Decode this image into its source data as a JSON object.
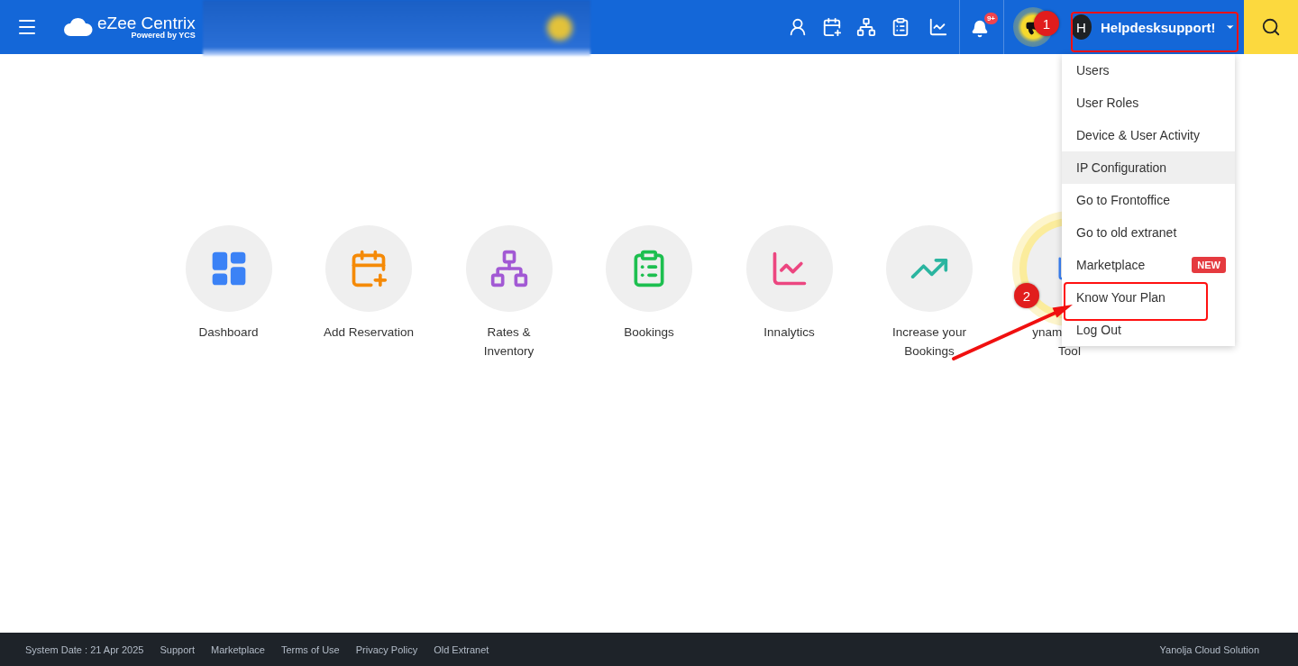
{
  "header": {
    "logo": {
      "name": "eZee Centrix",
      "tagline": "Powered by YCS"
    },
    "notifications": {
      "badge": "9+"
    },
    "user": {
      "initial": "H",
      "name": "Helpdesksupport!"
    }
  },
  "user_menu": {
    "open": true,
    "items": [
      {
        "label": "Users",
        "selected": false
      },
      {
        "label": "User Roles",
        "selected": false
      },
      {
        "label": "Device & User Activity",
        "selected": false
      },
      {
        "label": "IP Configuration",
        "selected": true
      },
      {
        "label": "Go to Frontoffice",
        "selected": false
      },
      {
        "label": "Go to old extranet",
        "selected": false
      },
      {
        "label": "Marketplace",
        "selected": false,
        "badge": "NEW"
      },
      {
        "label": "Know Your Plan",
        "selected": false
      },
      {
        "label": "Log Out",
        "selected": false
      }
    ]
  },
  "tiles": [
    {
      "lines": [
        "Dashboard"
      ],
      "highlighted": false
    },
    {
      "lines": [
        "Add Reservation"
      ],
      "highlighted": false
    },
    {
      "lines": [
        "Rates &",
        "Inventory"
      ],
      "highlighted": false
    },
    {
      "lines": [
        "Bookings"
      ],
      "highlighted": false
    },
    {
      "lines": [
        "Innalytics"
      ],
      "highlighted": false
    },
    {
      "lines": [
        "Increase your",
        "Bookings"
      ],
      "highlighted": false
    },
    {
      "lines": [
        "ynam",
        "Tool"
      ],
      "highlighted": true
    }
  ],
  "annotations": [
    {
      "number": "1"
    },
    {
      "number": "2"
    }
  ],
  "footer": {
    "date": "System Date : 21 Apr 2025",
    "links": [
      "Support",
      "Marketplace",
      "Terms of Use",
      "Privacy Policy",
      "Old Extranet"
    ],
    "company": "Yanolja Cloud Solution"
  }
}
